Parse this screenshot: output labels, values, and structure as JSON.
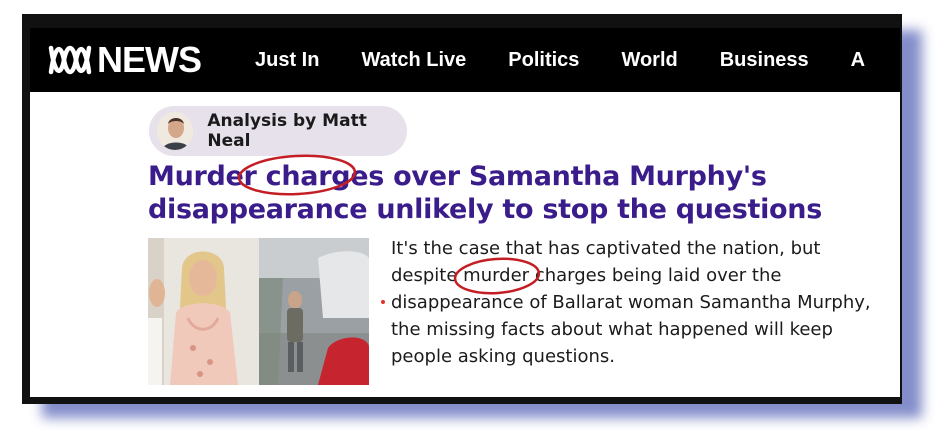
{
  "site": {
    "logo_text": "NEWS"
  },
  "nav": {
    "items": [
      "Just In",
      "Watch Live",
      "Politics",
      "World",
      "Business",
      "A"
    ]
  },
  "article": {
    "byline": "Analysis by Matt Neal",
    "headline": {
      "before": "Murder ",
      "highlight": "charges",
      "after": " over Samantha Murphy's disappearance unlikely to stop the questions"
    },
    "summary": {
      "before": "It's the case that has captivated the nation, but despite murder ",
      "highlight": "charges",
      "after": " being laid over the disappearance of Ballarat woman Samantha Murphy, the missing facts about what happened will keep people asking questions."
    }
  },
  "colors": {
    "headline": "#3a1d8a",
    "annotation_circle": "#c41e24",
    "frame_shadow": "#5a67b8"
  },
  "icons": {
    "logo": "abc-lissajous-logo",
    "author": "author-avatar"
  }
}
